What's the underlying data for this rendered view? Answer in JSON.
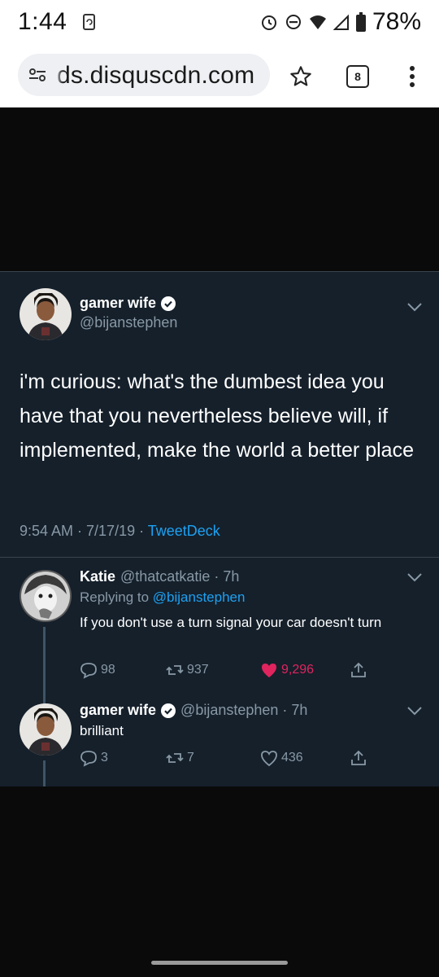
{
  "status_bar": {
    "time": "1:44",
    "battery": "78%"
  },
  "browser": {
    "url": "ds.disquscdn.com",
    "tab_count": "8"
  },
  "main_tweet": {
    "display_name": "gamer wife",
    "handle": "@bijanstephen",
    "text": "i'm curious: what's the dumbest idea you have that you nevertheless believe will, if implemented, make the world a better place",
    "time": "9:54 AM · 7/17/19 · ",
    "source": "TweetDeck"
  },
  "reply_1": {
    "display_name": "Katie",
    "handle_time": "@thatcatkatie · 7h",
    "replying_prefix": "Replying to ",
    "replying_handle": "@bijanstephen",
    "text": "If you don't use a turn signal your car doesn't turn",
    "replies": "98",
    "retweets": "937",
    "likes": "9,296"
  },
  "reply_2": {
    "display_name": "gamer wife",
    "handle_time": "@bijanstephen · 7h",
    "text": "brilliant",
    "replies": "3",
    "retweets": "7",
    "likes": "436"
  },
  "colors": {
    "card_bg": "#15202b",
    "accent_blue": "#1da1f2",
    "like_pink": "#e0245e",
    "muted": "#8899a6"
  }
}
